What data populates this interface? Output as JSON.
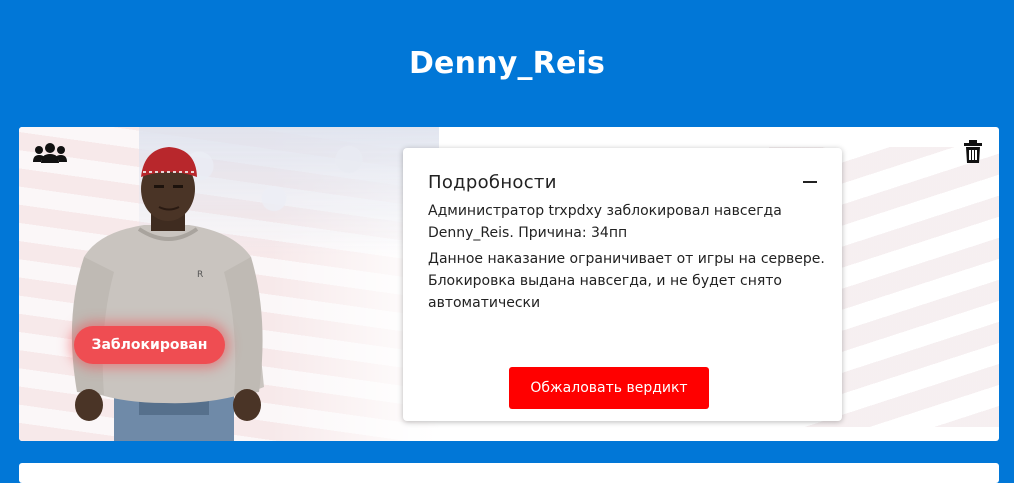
{
  "page": {
    "title": "Denny_Reis"
  },
  "card": {
    "status_badge": "Заблокирован",
    "icons": {
      "group": "users-icon",
      "delete": "trash-icon",
      "collapse": "minus-icon"
    },
    "details": {
      "title": "Подробности",
      "text_1": "Администратор trxpdxy заблокировал навсегда Denny_Reis. Причина: 34пп",
      "text_2": "Данное наказание ограничивает от игры на сервере. Блокировка выдана навсегда, и не будет снято автоматически",
      "appeal_button": "Обжаловать вердикт"
    }
  },
  "colors": {
    "background": "#0177d7",
    "badge": "#ef4d52",
    "appeal_button": "#ff0000"
  }
}
